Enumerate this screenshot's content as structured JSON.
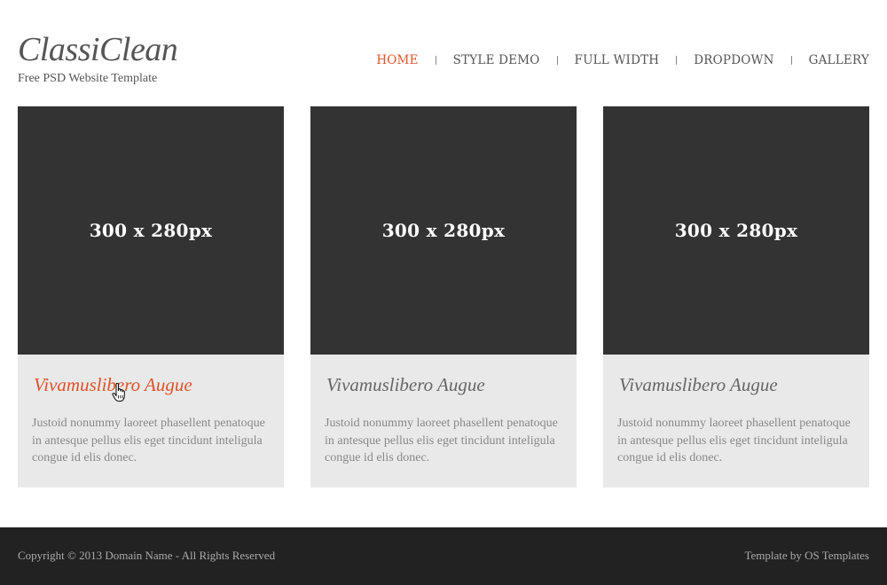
{
  "header": {
    "logo": "ClassiClean",
    "tagline": "Free PSD Website Template"
  },
  "nav": {
    "items": [
      {
        "label": "HOME",
        "active": true
      },
      {
        "label": "STYLE DEMO",
        "active": false
      },
      {
        "label": "FULL WIDTH",
        "active": false
      },
      {
        "label": "DROPDOWN",
        "active": false
      },
      {
        "label": "GALLERY",
        "active": false
      }
    ]
  },
  "cards": [
    {
      "image_text": "300 x 280px",
      "title": "Vivamuslibero Augue",
      "description": "Justoid nonummy laoreet phasellent penatoque in antesque pellus elis eget tincidunt inteligula congue id elis donec.",
      "hovered": true
    },
    {
      "image_text": "300 x 280px",
      "title": "Vivamuslibero Augue",
      "description": "Justoid nonummy laoreet phasellent penatoque in antesque pellus elis eget tincidunt inteligula congue id elis donec.",
      "hovered": false
    },
    {
      "image_text": "300 x 280px",
      "title": "Vivamuslibero Augue",
      "description": "Justoid nonummy laoreet phasellent penatoque in antesque pellus elis eget tincidunt inteligula congue id elis donec.",
      "hovered": false
    }
  ],
  "footer": {
    "copyright": "Copyright © 2013 Domain Name - All Rights Reserved",
    "credit": "Template by OS Templates"
  },
  "colors": {
    "accent": "#e0522a",
    "thumb_bg": "#333333",
    "card_bg": "#e9e9e9",
    "footer_bg": "#222222"
  },
  "cursor_icon": "hand-pointer-icon"
}
